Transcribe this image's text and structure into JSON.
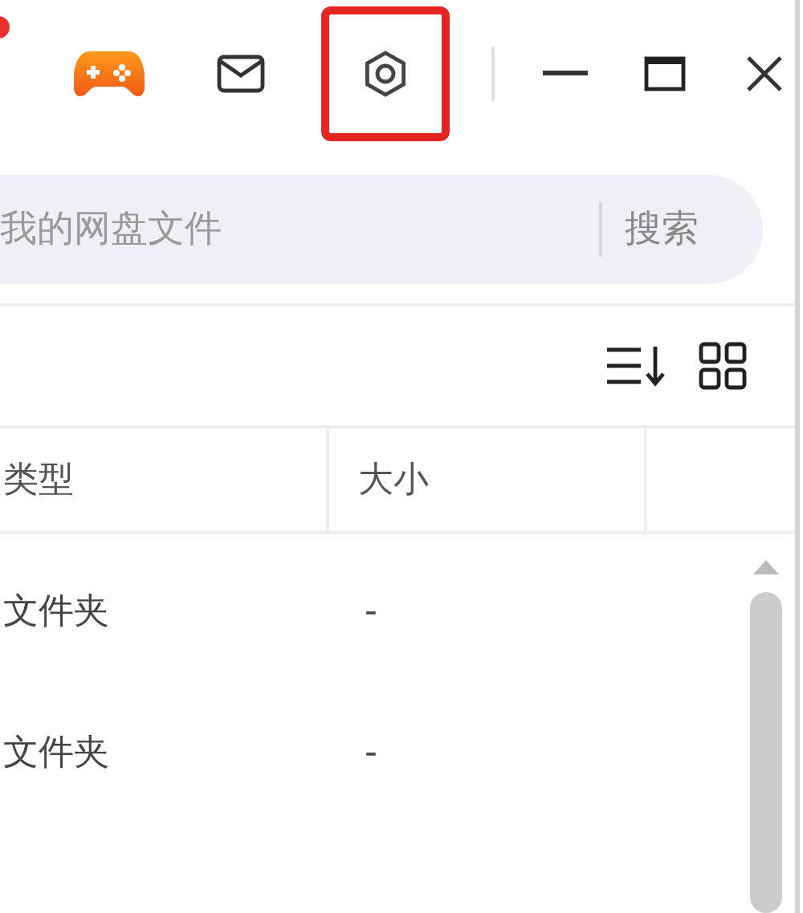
{
  "title_bar": {
    "buttons": [
      {
        "kind": "game",
        "highlighted": false
      },
      {
        "kind": "mail",
        "highlighted": false
      },
      {
        "kind": "settings",
        "highlighted": true
      },
      {
        "kind": "minimize",
        "highlighted": false
      },
      {
        "kind": "maximize",
        "highlighted": false
      },
      {
        "kind": "close",
        "highlighted": false
      }
    ]
  },
  "search": {
    "placeholder": "我的网盘文件",
    "button": "搜索"
  },
  "toolbar": [
    {
      "kind": "sort"
    },
    {
      "kind": "grid"
    }
  ],
  "table": {
    "columns": [
      "类型",
      "大小"
    ],
    "rows": [
      [
        "文件夹",
        "-"
      ],
      [
        "文件夹",
        "-"
      ]
    ]
  }
}
